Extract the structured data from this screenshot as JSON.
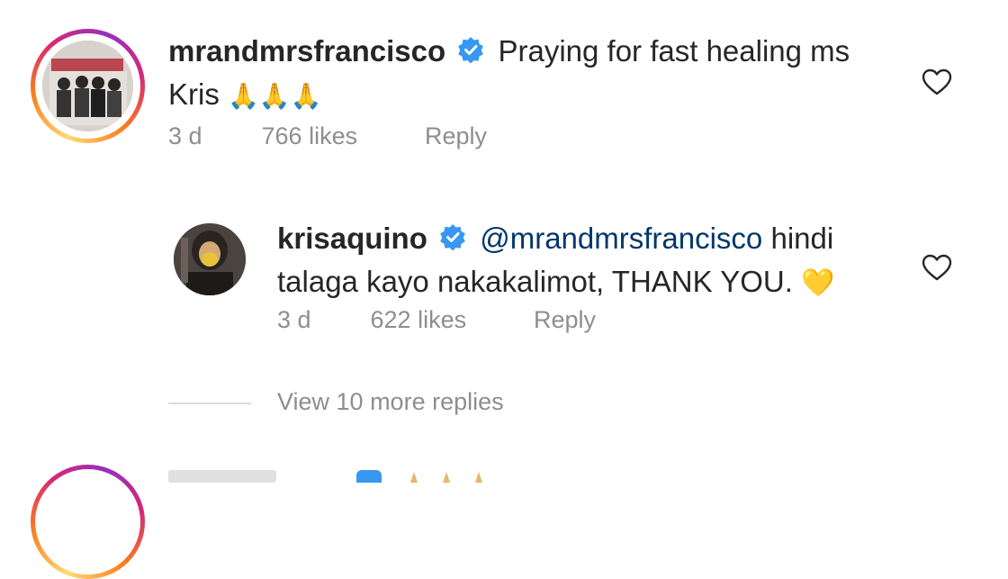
{
  "comments": [
    {
      "username": "mrandmrsfrancisco",
      "text": "Praying for fast healing ms Kris",
      "emoji": "🙏🙏🙏",
      "time": "3 d",
      "likes": "766 likes",
      "reply": "Reply"
    }
  ],
  "reply": {
    "username": "krisaquino",
    "mention": "@mrandmrsfrancisco",
    "text_after_mention": " hindi talaga kayo nakakalimot, THANK YOU.",
    "emoji": "💛",
    "time": "3 d",
    "likes": "622 likes",
    "reply": "Reply"
  },
  "view_more": "View 10 more replies",
  "icons": {
    "verified": "verified-badge-icon",
    "heart": "heart-outline-icon"
  },
  "colors": {
    "verified_blue": "#3897f0",
    "mention": "#00376b",
    "meta_gray": "#8e8e8e"
  }
}
